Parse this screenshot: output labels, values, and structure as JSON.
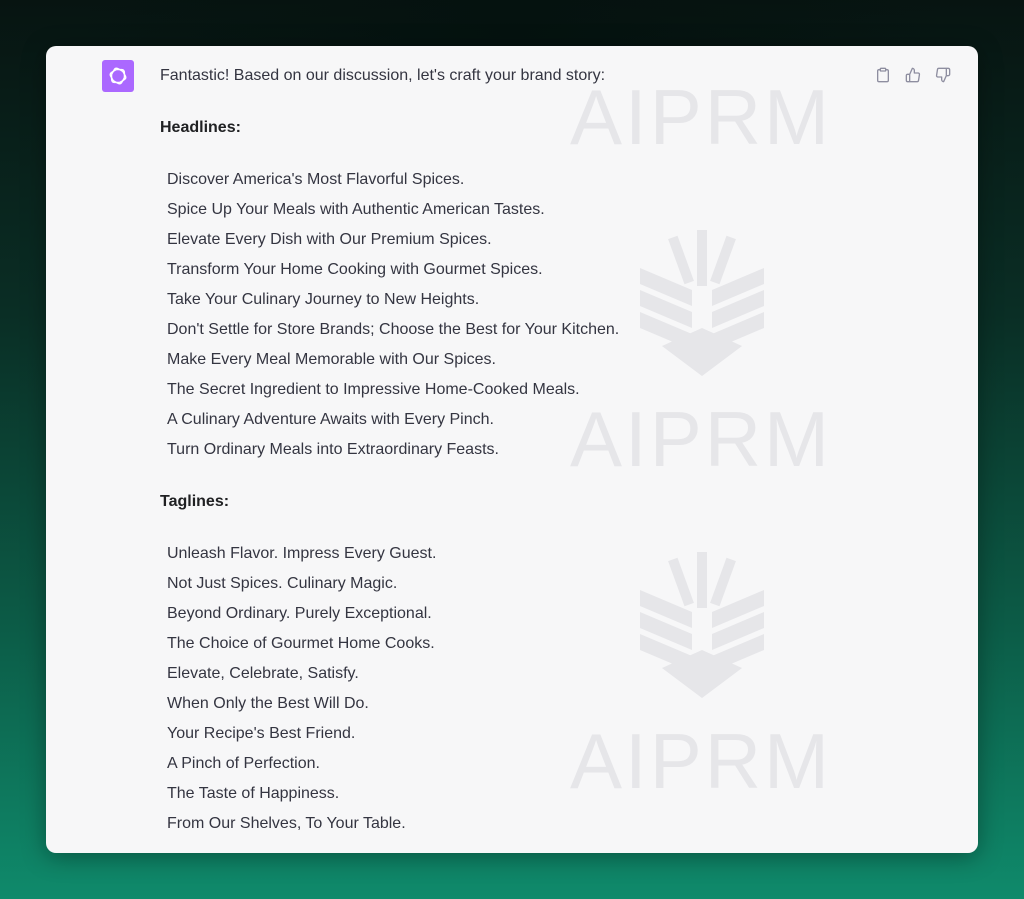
{
  "watermark": {
    "text": "AIPRM"
  },
  "message": {
    "intro": "Fantastic! Based on our discussion, let's craft your brand story:",
    "headlines_title": "Headlines:",
    "headlines": [
      "Discover America's Most Flavorful Spices.",
      "Spice Up Your Meals with Authentic American Tastes.",
      "Elevate Every Dish with Our Premium Spices.",
      "Transform Your Home Cooking with Gourmet Spices.",
      "Take Your Culinary Journey to New Heights.",
      "Don't Settle for Store Brands; Choose the Best for Your Kitchen.",
      "Make Every Meal Memorable with Our Spices.",
      "The Secret Ingredient to Impressive Home-Cooked Meals.",
      "A Culinary Adventure Awaits with Every Pinch.",
      "Turn Ordinary Meals into Extraordinary Feasts."
    ],
    "taglines_title": "Taglines:",
    "taglines": [
      "Unleash Flavor. Impress Every Guest.",
      "Not Just Spices. Culinary Magic.",
      "Beyond Ordinary. Purely Exceptional.",
      "The Choice of Gourmet Home Cooks.",
      "Elevate, Celebrate, Satisfy.",
      "When Only the Best Will Do.",
      "Your Recipe's Best Friend.",
      "A Pinch of Perfection.",
      "The Taste of Happiness.",
      "From Our Shelves, To Your Table."
    ]
  },
  "icons": {
    "avatar": "openai-logo-icon",
    "copy": "clipboard-icon",
    "like": "thumbs-up-icon",
    "dislike": "thumbs-down-icon"
  },
  "colors": {
    "avatar_bg": "#ab68ff",
    "card_bg": "#f7f7f8",
    "text": "#343541"
  }
}
